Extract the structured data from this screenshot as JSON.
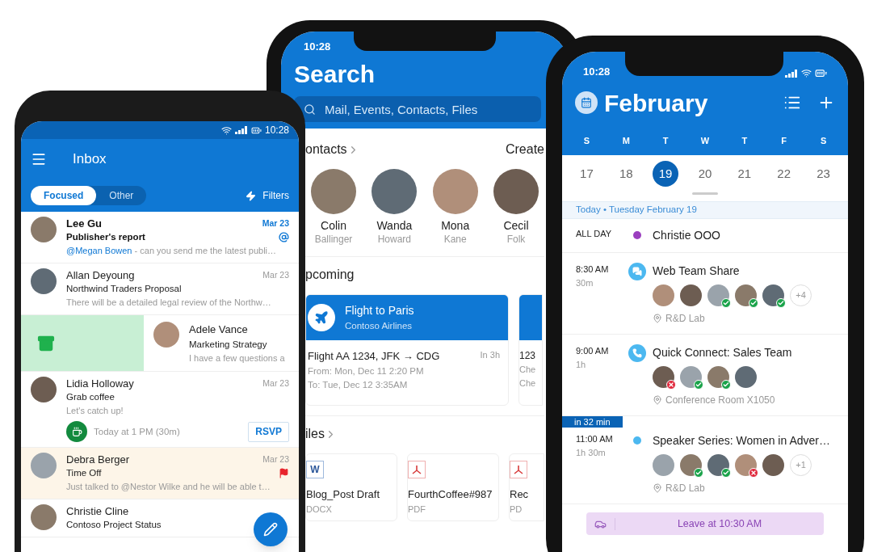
{
  "inbox_phone": {
    "status_time": "10:28",
    "title": "Inbox",
    "tabs": [
      {
        "label": "Focused",
        "selected": true
      },
      {
        "label": "Other",
        "selected": false
      }
    ],
    "filter_label": "Filters",
    "messages": [
      {
        "kind": "mail",
        "sender": "Lee Gu",
        "date": "Mar 23",
        "unread": true,
        "subject": "Publisher's report",
        "mention": "@Megan Bowen",
        "preview": " - can you send me the latest publi…",
        "mentioned": true,
        "flagged": false,
        "highlighted": false
      },
      {
        "kind": "mail",
        "sender": "Allan Deyoung",
        "date": "Mar 23",
        "unread": false,
        "subject": "Northwind Traders Proposal",
        "preview": "There will be a detailed legal review of the Northw…",
        "mentioned": false,
        "flagged": false,
        "highlighted": false
      },
      {
        "kind": "swiped",
        "sender": "Adele Vance",
        "subject": "Marketing Strategy",
        "preview": "I have a few questions a"
      },
      {
        "kind": "mail",
        "sender": "Lidia Holloway",
        "date": "Mar 23",
        "unread": false,
        "subject": "Grab coffee",
        "preview": "Let's catch up!",
        "event": {
          "time": "Today at 1 PM (30m)",
          "action": "RSVP"
        },
        "mentioned": false,
        "flagged": false,
        "highlighted": false
      },
      {
        "kind": "mail",
        "sender": "Debra Berger",
        "date": "Mar 23",
        "unread": false,
        "subject": "Time Off",
        "preview": "Just talked to @Nestor Wilke and he will be able t…",
        "mentioned": false,
        "flagged": true,
        "highlighted": true
      },
      {
        "kind": "mail",
        "sender": "Christie Cline",
        "unread": false,
        "subject": "Contoso Project Status",
        "mentioned": false,
        "flagged": false,
        "highlighted": false
      }
    ]
  },
  "search_phone": {
    "status_time": "10:28",
    "title": "Search",
    "search": {
      "placeholder": "Mail, Events, Contacts, Files"
    },
    "contacts_heading": "ontacts",
    "create_label": "Create",
    "contacts": [
      {
        "first": "Colin",
        "last": "Ballinger"
      },
      {
        "first": "Wanda",
        "last": "Howard"
      },
      {
        "first": "Mona",
        "last": "Kane"
      },
      {
        "first": "Cecil",
        "last": "Folk"
      }
    ],
    "upcoming_heading": "pcoming",
    "trip": {
      "title": "Flight to Paris",
      "airline": "Contoso Airlines",
      "flight": "Flight AA 1234, JFK → CDG",
      "eta": "In 3h",
      "from": "From: Mon, Dec 11 2:20 PM",
      "to": "To: Tue, Dec 12 3:35AM"
    },
    "trip_2": {
      "line_1": "123",
      "line_2": "Che",
      "line_3": "Che"
    },
    "files_heading": "iles",
    "files": [
      {
        "kind": "docx",
        "icon_letter": "W",
        "name": "Blog_Post Draft",
        "type": "DOCX"
      },
      {
        "kind": "pdf",
        "name": "FourthCoffee#987",
        "type": "PDF"
      },
      {
        "kind": "pdf",
        "name": "Rec",
        "type": "PD"
      }
    ]
  },
  "calendar_phone": {
    "status_time": "10:28",
    "title": "February",
    "weekdays": [
      "S",
      "M",
      "T",
      "W",
      "T",
      "F",
      "S"
    ],
    "dates": [
      {
        "day": "17",
        "selected": false
      },
      {
        "day": "18",
        "selected": false
      },
      {
        "day": "19",
        "selected": true
      },
      {
        "day": "20",
        "selected": false
      },
      {
        "day": "21",
        "selected": false
      },
      {
        "day": "22",
        "selected": false
      },
      {
        "day": "23",
        "selected": false
      }
    ],
    "today_label": "Today • Tuesday February 19",
    "events": [
      {
        "kind": "dot",
        "color": "#9b3fbf",
        "time": "ALL DAY",
        "title": "Christie OOO"
      },
      {
        "kind": "chat",
        "time": "8:30 AM",
        "duration": "30m",
        "title": "Web Team Share",
        "attendees": [
          {
            "accepted": false,
            "declined": false
          },
          {
            "accepted": false,
            "declined": false
          },
          {
            "accepted": true,
            "declined": false
          },
          {
            "accepted": true,
            "declined": false
          },
          {
            "accepted": true,
            "declined": false
          }
        ],
        "more": "+4",
        "location": "R&D Lab"
      },
      {
        "kind": "phone",
        "time": "9:00 AM",
        "duration": "1h",
        "title": "Quick Connect: Sales Team",
        "attendees": [
          {
            "accepted": false,
            "declined": true
          },
          {
            "accepted": true,
            "declined": false
          },
          {
            "accepted": true,
            "declined": false
          },
          {
            "accepted": false,
            "declined": false
          }
        ],
        "location": "Conference Room X1050"
      },
      {
        "kind": "dot",
        "color": "#4cb8f0",
        "badge": "in 32 min",
        "time": "11:00 AM",
        "duration": "1h 30m",
        "title": "Speaker Series: Women in Adver…",
        "attendees": [
          {
            "accepted": false,
            "declined": false
          },
          {
            "accepted": true,
            "declined": false
          },
          {
            "accepted": true,
            "declined": false
          },
          {
            "accepted": false,
            "declined": true
          },
          {
            "accepted": false,
            "declined": false
          }
        ],
        "more": "+1",
        "location": "R&D Lab"
      }
    ],
    "leave_banner": "Leave at 10:30 AM"
  }
}
